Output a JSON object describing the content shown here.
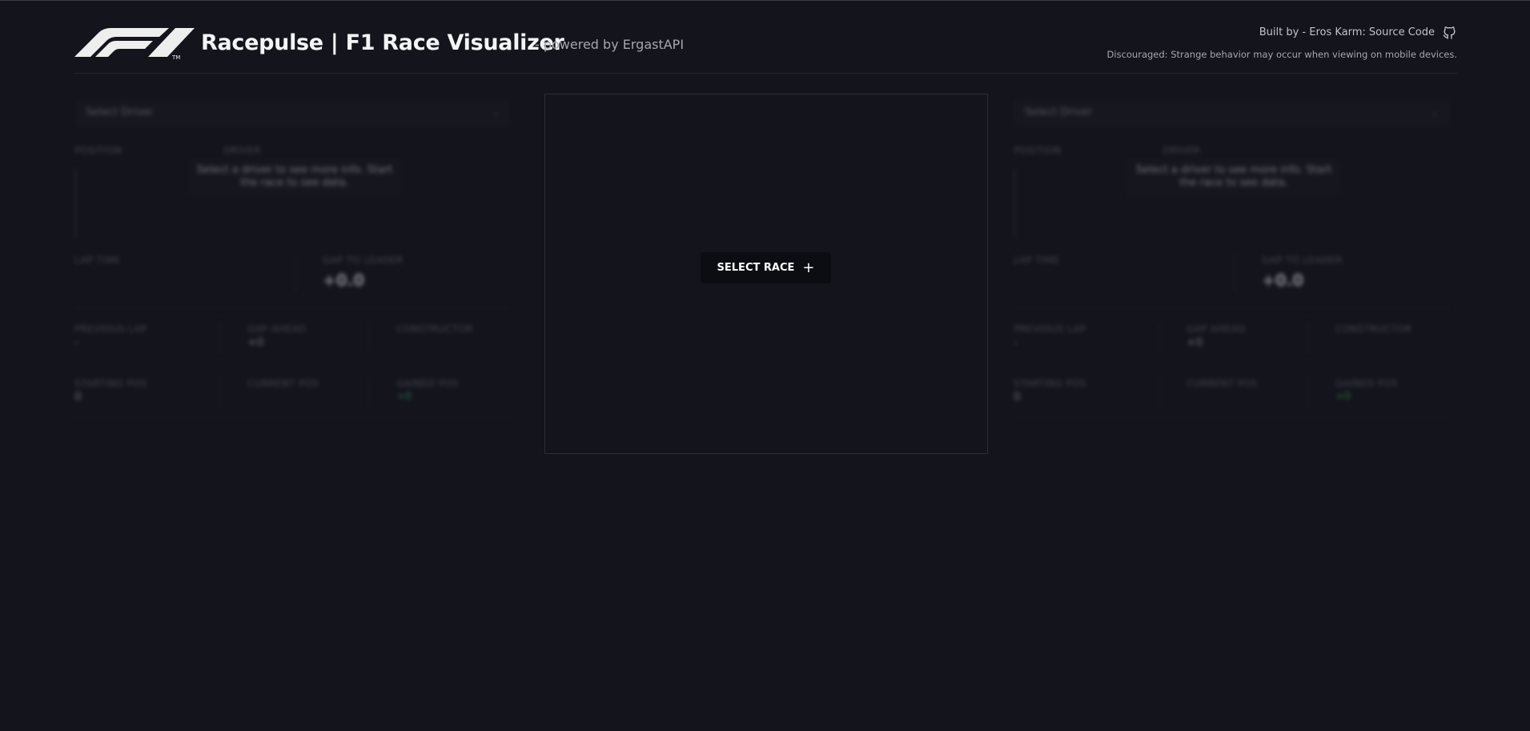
{
  "header": {
    "title": "Racepulse | F1 Race Visualizer",
    "powered": "- powered by ErgastAPI",
    "built_by": "Built by - Eros Karm: Source Code",
    "discouraged": "Discouraged: Strange behavior may occur when viewing on mobile devices.",
    "logo_icon": "f1-logo",
    "github_icon": "github-icon"
  },
  "center": {
    "select_race_label": "SELECT RACE",
    "plus_icon": "+"
  },
  "panel": {
    "select_driver": "Select Driver",
    "chevron": "⌄",
    "position_label": "POSITION",
    "driver_label": "DRIVER",
    "tooltip": "Select a driver to see more info. Start the race to see data.",
    "lap_time_label": "LAP TIME",
    "gap_to_leader_label": "GAP TO LEADER",
    "gap_to_leader_value": "+0.0",
    "previous_lap_label": "PREVIOUS LAP",
    "previous_lap_value": "-",
    "gap_ahead_label": "GAP AHEAD",
    "gap_ahead_value": "+0",
    "constructor_label": "CONSTRUCTOR",
    "starting_pos_label": "STARTING POS",
    "starting_pos_value": "0",
    "current_pos_label": "CURRENT POS",
    "gained_pos_label": "GAINED POS",
    "gained_pos_value": "+0"
  },
  "colors": {
    "background": "#13141c",
    "button": "#0c0d12",
    "positive": "#3dbb63"
  }
}
